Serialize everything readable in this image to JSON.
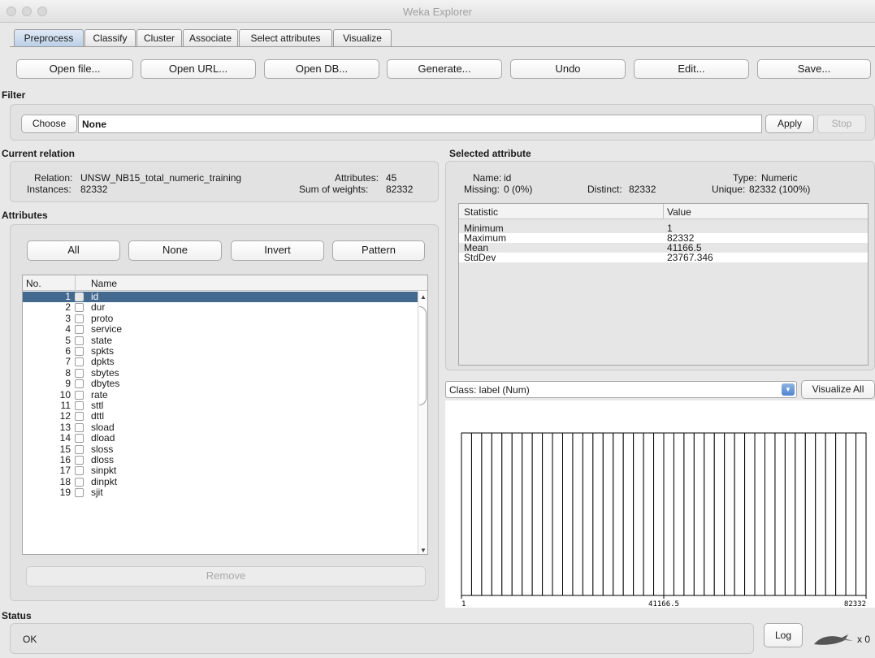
{
  "window": {
    "title": "Weka Explorer"
  },
  "tabs": [
    "Preprocess",
    "Classify",
    "Cluster",
    "Associate",
    "Select attributes",
    "Visualize"
  ],
  "toolbar": [
    "Open file...",
    "Open URL...",
    "Open DB...",
    "Generate...",
    "Undo",
    "Edit...",
    "Save..."
  ],
  "filter": {
    "section": "Filter",
    "choose": "Choose",
    "value": "None",
    "apply": "Apply",
    "stop": "Stop"
  },
  "relation": {
    "section": "Current relation",
    "relation_label": "Relation:",
    "relation_value": "UNSW_NB15_total_numeric_training",
    "instances_label": "Instances:",
    "instances_value": "82332",
    "attributes_label": "Attributes:",
    "attributes_value": "45",
    "weights_label": "Sum of weights:",
    "weights_value": "82332"
  },
  "attributes": {
    "section": "Attributes",
    "buttons": [
      "All",
      "None",
      "Invert",
      "Pattern"
    ],
    "col_no": "No.",
    "col_name": "Name",
    "rows": [
      {
        "no": "1",
        "name": "id",
        "selected": true
      },
      {
        "no": "2",
        "name": "dur"
      },
      {
        "no": "3",
        "name": "proto"
      },
      {
        "no": "4",
        "name": "service"
      },
      {
        "no": "5",
        "name": "state"
      },
      {
        "no": "6",
        "name": "spkts"
      },
      {
        "no": "7",
        "name": "dpkts"
      },
      {
        "no": "8",
        "name": "sbytes"
      },
      {
        "no": "9",
        "name": "dbytes"
      },
      {
        "no": "10",
        "name": "rate"
      },
      {
        "no": "11",
        "name": "sttl"
      },
      {
        "no": "12",
        "name": "dttl"
      },
      {
        "no": "13",
        "name": "sload"
      },
      {
        "no": "14",
        "name": "dload"
      },
      {
        "no": "15",
        "name": "sloss"
      },
      {
        "no": "16",
        "name": "dloss"
      },
      {
        "no": "17",
        "name": "sinpkt"
      },
      {
        "no": "18",
        "name": "dinpkt"
      },
      {
        "no": "19",
        "name": "sjit"
      }
    ],
    "remove": "Remove"
  },
  "selected": {
    "section": "Selected attribute",
    "name_label": "Name:",
    "name_value": "id",
    "type_label": "Type:",
    "type_value": "Numeric",
    "missing_label": "Missing:",
    "missing_value": "0 (0%)",
    "distinct_label": "Distinct:",
    "distinct_value": "82332",
    "unique_label": "Unique:",
    "unique_value": "82332 (100%)",
    "col_statistic": "Statistic",
    "col_value": "Value",
    "stats": [
      {
        "stat": "Minimum",
        "value": "1"
      },
      {
        "stat": "Maximum",
        "value": "82332"
      },
      {
        "stat": "Mean",
        "value": "41166.5"
      },
      {
        "stat": "StdDev",
        "value": "23767.346"
      }
    ]
  },
  "class_select": {
    "value": "Class: label (Num)",
    "visualize_all": "Visualize All"
  },
  "chart_data": {
    "type": "bar",
    "bins": 40,
    "x_min_label": "1",
    "x_mid_label": "41166.5",
    "x_max_label": "82332",
    "values": [
      1,
      1,
      1,
      1,
      1,
      1,
      1,
      1,
      1,
      1,
      1,
      1,
      1,
      1,
      1,
      1,
      1,
      1,
      1,
      1,
      1,
      1,
      1,
      1,
      1,
      1,
      1,
      1,
      1,
      1,
      1,
      1,
      1,
      1,
      1,
      1,
      1,
      1,
      1,
      1
    ]
  },
  "status": {
    "section": "Status",
    "text": "OK",
    "log": "Log",
    "count": "x 0"
  }
}
